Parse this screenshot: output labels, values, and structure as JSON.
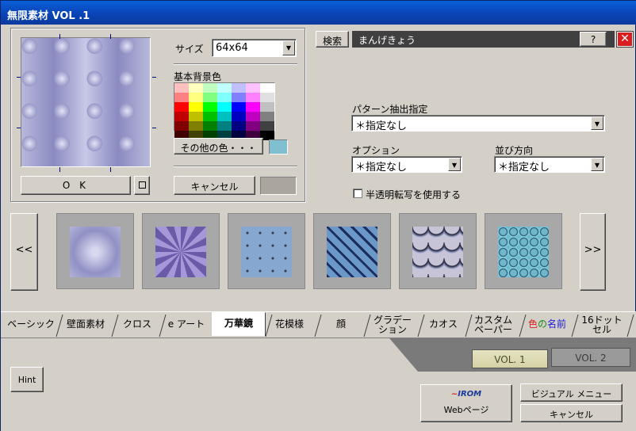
{
  "title": "無限素材 VOL .1",
  "size_label": "サイズ",
  "size_value": "64x64",
  "bg_color_label": "基本背景色",
  "other_colors_button": "その他の色・・・",
  "ok_button": "O K",
  "cancel_button_small": "キャンセル",
  "search_button": "検索",
  "search_value": "まんげきょう",
  "help_button": "?",
  "pattern_label": "パターン抽出指定",
  "pattern_value": "＊指定なし",
  "option_label": "オプション",
  "option_value": "＊指定なし",
  "direction_label": "並び方向",
  "direction_value": "＊指定なし",
  "semi_transparent_label": "半透明転写を使用する",
  "prev_button": "<<",
  "next_button": ">>",
  "tabs": [
    "ベーシック",
    "壁面素材",
    "クロス",
    "e アート",
    "万華鏡",
    "花模様",
    "顔",
    "グラデーション",
    "カオス",
    "カスタムペーパー",
    "色の名前",
    "16ドットセル"
  ],
  "tab_lines": {
    "gradation": [
      "グラデー",
      "ション"
    ],
    "custom": [
      "カスタム",
      "ペーパー"
    ],
    "color_name": [
      "色",
      "の",
      "名前"
    ],
    "dot": [
      "16ドット",
      "セル"
    ]
  },
  "vol1": "VOL. 1",
  "vol2": "VOL. 2",
  "hint_button": "Hint",
  "web_button": "Webページ",
  "web_logo": "IROM",
  "visual_menu_button": "ビジュアル メニュー",
  "cancel_button": "キャンセル",
  "colors": {
    "title_bar": "#0a4fc7",
    "selected_color": "#7fbfcf",
    "accent_red": "#d81e1e"
  },
  "palette": [
    [
      "#ffc0c0",
      "#ffffc0",
      "#c0ffc0",
      "#c0ffff",
      "#c0c0ff",
      "#ffc0ff",
      "#ffffff"
    ],
    [
      "#ff8080",
      "#ffff80",
      "#80ff80",
      "#80ffff",
      "#8080ff",
      "#ff80ff",
      "#e0e0e0"
    ],
    [
      "#ff0000",
      "#ffff00",
      "#00ff00",
      "#00ffff",
      "#0000ff",
      "#ff00ff",
      "#c0c0c0"
    ],
    [
      "#c00000",
      "#c0c000",
      "#00c000",
      "#00c0c0",
      "#0000c0",
      "#c000c0",
      "#808080"
    ],
    [
      "#800000",
      "#808000",
      "#008000",
      "#008080",
      "#000080",
      "#800080",
      "#404040"
    ],
    [
      "#400000",
      "#404000",
      "#004000",
      "#004040",
      "#000040",
      "#400040",
      "#000000"
    ]
  ]
}
